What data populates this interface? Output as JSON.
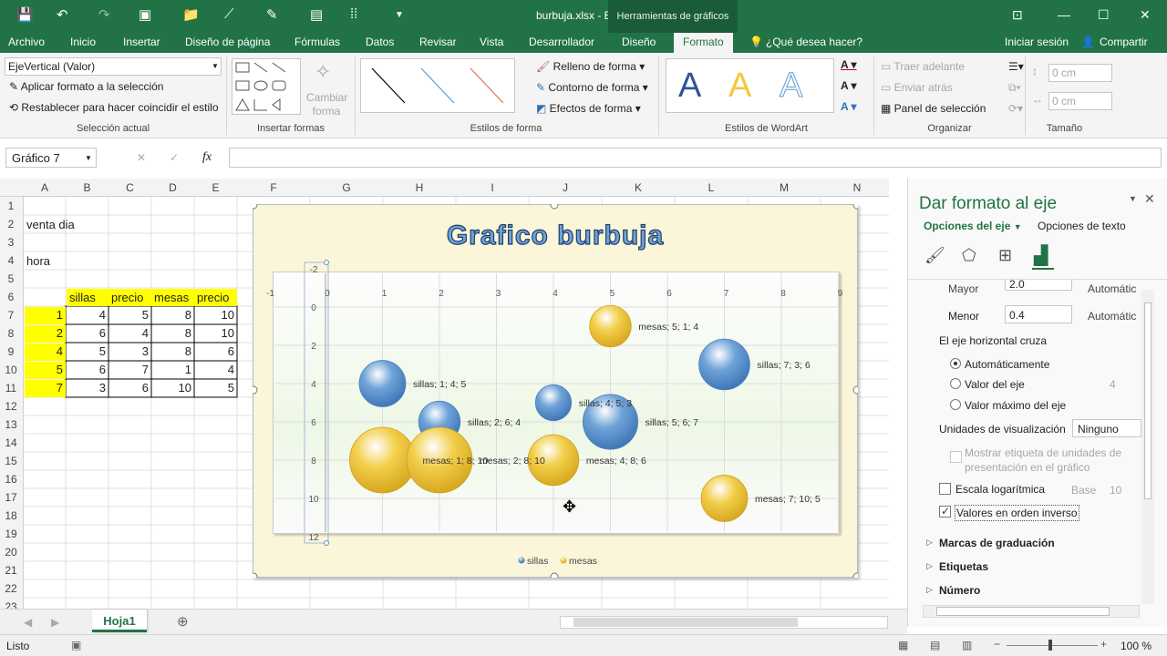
{
  "app": {
    "title": "burbuja.xlsx - Excel",
    "context_tab": "Herramientas de gráficos"
  },
  "tabs": [
    "Archivo",
    "Inicio",
    "Insertar",
    "Diseño de página",
    "Fórmulas",
    "Datos",
    "Revisar",
    "Vista",
    "Desarrollador",
    "Diseño",
    "Formato"
  ],
  "tell_me": "¿Qué desea hacer?",
  "signin": "Iniciar sesión",
  "share": "Compartir",
  "ribbon": {
    "selection": {
      "dropdown": "EjeVertical (Valor)",
      "apply": "Aplicar formato a la selección",
      "reset": "Restablecer para hacer coincidir el estilo",
      "label": "Selección actual"
    },
    "insert_shapes": {
      "change_shape": "Cambiar forma",
      "label": "Insertar formas"
    },
    "shape_styles": {
      "fill": "Relleno de forma",
      "outline": "Contorno de forma",
      "effects": "Efectos de forma",
      "label": "Estilos de forma"
    },
    "wordart": {
      "glyph": "A",
      "label": "Estilos de WordArt"
    },
    "arrange": {
      "forward": "Traer adelante",
      "back": "Enviar atrás",
      "selection_pane": "Panel de selección",
      "label": "Organizar"
    },
    "size": {
      "height": "0 cm",
      "width": "0 cm",
      "label": "Tamaño"
    }
  },
  "formula_bar": {
    "name_box": "Gráfico 7",
    "fx": "fx",
    "cancel": "✕",
    "enter": "✓"
  },
  "columns": [
    "A",
    "B",
    "C",
    "D",
    "E",
    "F",
    "G",
    "H",
    "I",
    "J",
    "K",
    "L",
    "M",
    "N"
  ],
  "rows": [
    "1",
    "2",
    "3",
    "4",
    "5",
    "6",
    "7",
    "8",
    "9",
    "10",
    "11",
    "12",
    "13",
    "14",
    "15",
    "16",
    "17",
    "18",
    "19",
    "20",
    "21",
    "22",
    "23"
  ],
  "sheet": {
    "a2": "venta dia",
    "a4": "hora",
    "headers": [
      "sillas",
      "precio",
      "mesas",
      "precio"
    ],
    "data": [
      [
        "1",
        "4",
        "5",
        "8",
        "10"
      ],
      [
        "2",
        "6",
        "4",
        "8",
        "10"
      ],
      [
        "4",
        "5",
        "3",
        "8",
        "6"
      ],
      [
        "5",
        "6",
        "7",
        "1",
        "4"
      ],
      [
        "7",
        "3",
        "6",
        "10",
        "5"
      ]
    ]
  },
  "chart_data": {
    "type": "bubble",
    "title": "Grafico burbuja",
    "x_ticks": [
      "-1",
      "0",
      "1",
      "2",
      "3",
      "4",
      "5",
      "6",
      "7",
      "8",
      "9"
    ],
    "y_ticks": [
      "-2",
      "0",
      "2",
      "4",
      "6",
      "8",
      "10",
      "12"
    ],
    "xlim": [
      -1,
      9
    ],
    "ylim": [
      -2,
      12
    ],
    "y_reversed": true,
    "legend_position": "bottom",
    "series": [
      {
        "name": "sillas",
        "color": "#6fa3d8",
        "points": [
          {
            "x": 1,
            "y": 4,
            "size": 5,
            "label": "sillas; 1; 4; 5"
          },
          {
            "x": 2,
            "y": 6,
            "size": 4,
            "label": "sillas; 2; 6; 4"
          },
          {
            "x": 4,
            "y": 5,
            "size": 3,
            "label": "sillas; 4; 5; 3"
          },
          {
            "x": 5,
            "y": 6,
            "size": 7,
            "label": "sillas; 5; 6; 7"
          },
          {
            "x": 7,
            "y": 3,
            "size": 6,
            "label": "sillas; 7; 3; 6"
          }
        ]
      },
      {
        "name": "mesas",
        "color": "#f2cf4a",
        "points": [
          {
            "x": 1,
            "y": 8,
            "size": 10,
            "label": "mesas; 1; 8; 10"
          },
          {
            "x": 2,
            "y": 8,
            "size": 10,
            "label": "mesas; 2; 8; 10"
          },
          {
            "x": 4,
            "y": 8,
            "size": 6,
            "label": "mesas; 4; 8; 6"
          },
          {
            "x": 5,
            "y": 1,
            "size": 4,
            "label": "mesas; 5; 1; 4"
          },
          {
            "x": 7,
            "y": 10,
            "size": 5,
            "label": "mesas; 7; 10; 5"
          }
        ]
      }
    ]
  },
  "pane": {
    "title": "Dar formato al eje",
    "tab_axis": "Opciones del eje",
    "tab_text": "Opciones de texto",
    "mayor_label": "Mayor",
    "mayor_value": "2.0",
    "auto1": "Automátic",
    "menor_label": "Menor",
    "menor_value": "0.4",
    "auto2": "Automátic",
    "cross_title": "El eje horizontal cruza",
    "opt_auto": "Automáticamente",
    "opt_value": "Valor del eje",
    "opt_value_num": "4",
    "opt_max": "Valor máximo del eje",
    "units_label": "Unidades de visualización",
    "units_value": "Ninguno",
    "show_units": "Mostrar etiqueta de unidades de presentación en el gráfico",
    "log_scale": "Escala logarítmica",
    "base_label": "Base",
    "base_value": "10",
    "reverse": "Valores en orden inverso",
    "marks": "Marcas de graduación",
    "labels": "Etiquetas",
    "number": "Número"
  },
  "sheet_tab": "Hoja1",
  "status": {
    "ready": "Listo",
    "zoom": "100 %"
  }
}
